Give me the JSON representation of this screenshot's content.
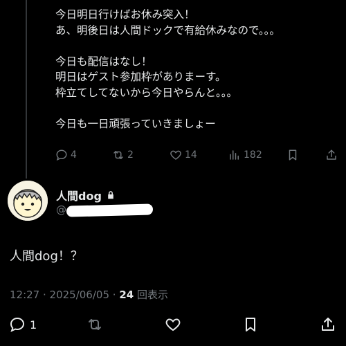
{
  "parent_tweet": {
    "paragraphs": [
      [
        "今日明日行けばお休み突入！",
        "あ、明後日は人間ドックで有給休みなので。。。"
      ],
      [
        "今日も配信はなし！",
        "明日はゲスト参加枠がありまーす。",
        "枠立てしてないから今日やらんと。。。"
      ],
      [
        "今日も一日頑張っていきましょー"
      ]
    ],
    "actions": {
      "replies": "4",
      "reposts": "2",
      "likes": "14",
      "views": "182"
    }
  },
  "main_tweet": {
    "author_name": "人間dog",
    "handle_prefix": "@",
    "text": "人間dog！？",
    "time": "12:27 · 2025/06/05 ·",
    "views_count": "24",
    "views_label": "回表示",
    "actions": {
      "replies": "1"
    }
  },
  "colors": {
    "background": "#000000",
    "text": "#e7e9ea",
    "muted": "#71767b",
    "divider": "#333639"
  }
}
